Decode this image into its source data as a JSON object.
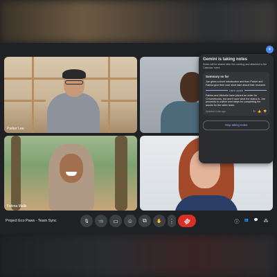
{
  "tiles": [
    {
      "name": "Parker Lee"
    },
    {
      "name": ""
    },
    {
      "name": "Fatima Malik"
    },
    {
      "name": ""
    }
  ],
  "gemini_panel": {
    "title": "Gemini is taking notes",
    "subtitle": "Notes will be shared after the meeting and attached to the Calendar event",
    "summary_heading": "Summary so far",
    "summary_text": "Joe gives a short introduction and then Parker and Fatima give their own short take about their research.",
    "latest_update_label": "Latest update",
    "latest_text": "Fatima and Michelle have placed an order for Chromebooks, but aren't sure what the status is. Joe proceeds to outline next steps for completing the assets for the sales team.",
    "updated_text": "Updated 4 min ago",
    "stop_label": "Stop taking notes"
  },
  "meeting": {
    "title": "Project Eco Paws - Team Sync"
  },
  "icons": {
    "mic": "🎙",
    "camera": "📹",
    "captions": "▭",
    "emoji": "☺",
    "present": "⧉",
    "raise_hand": "✋",
    "more": "⋮",
    "end_call": "☎",
    "info": "ⓘ",
    "people": "👥",
    "chat": "💬",
    "activities": "⁂",
    "refresh": "↻",
    "thumbs_up": "👍",
    "thumbs_down": "👎",
    "gemini": "✦"
  },
  "colors": {
    "accent": "#8ab4f8",
    "end_call": "#d93025",
    "gemini_badge": "#4c8df6"
  }
}
